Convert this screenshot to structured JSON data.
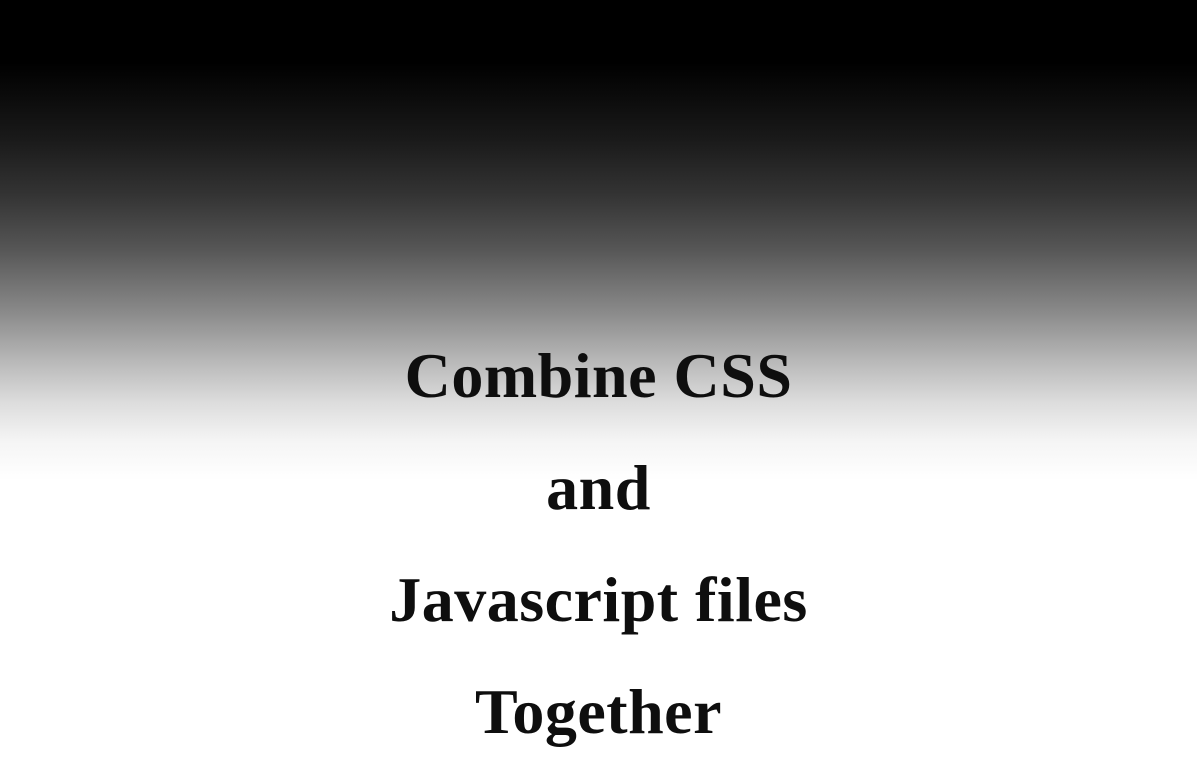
{
  "heading": {
    "line1": "Combine CSS",
    "line2": "and",
    "line3": "Javascript files",
    "line4": "Together"
  }
}
